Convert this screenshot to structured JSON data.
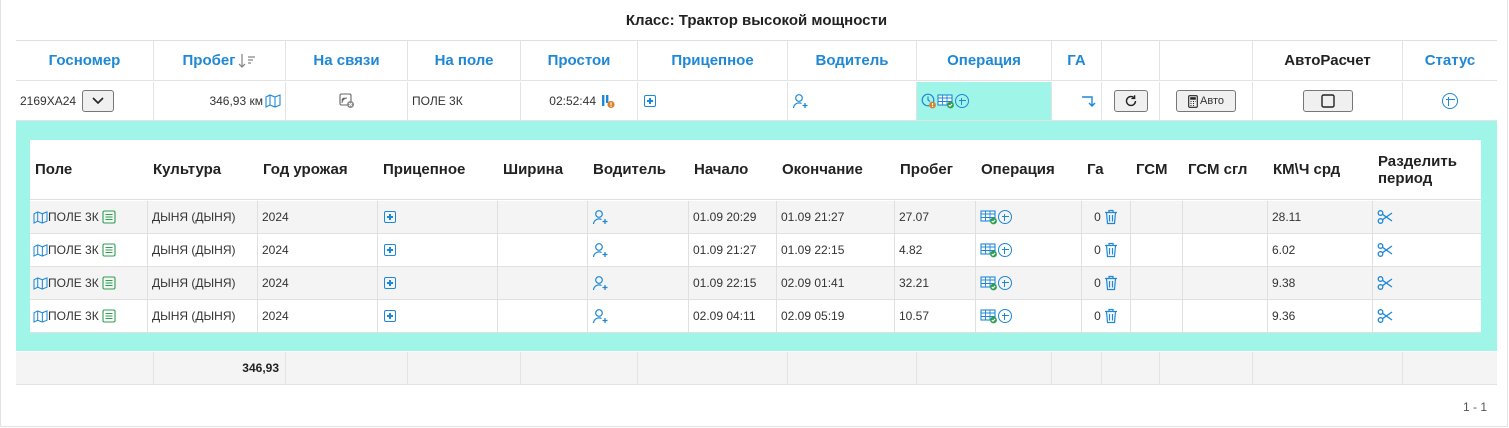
{
  "title": "Класс: Трактор высокой мощности",
  "main_columns": {
    "plate": "Госномер",
    "mileage": "Пробег",
    "online": "На связи",
    "in_field": "На поле",
    "idle": "Простои",
    "trailer": "Прицепное",
    "driver": "Водитель",
    "operation": "Операция",
    "ga": "ГА",
    "autocalc": "АвтоРасчет",
    "status": "Статус"
  },
  "vehicle": {
    "plate": "2169ХА24",
    "mileage": "346,93 км",
    "field": "ПОЛЕ 3К",
    "idle": "02:52:44",
    "auto_button": "Авто"
  },
  "sub_columns": {
    "field": "Поле",
    "crop": "Культура",
    "year": "Год урожая",
    "trailer": "Прицепное",
    "width": "Ширина",
    "driver": "Водитель",
    "start": "Начало",
    "end": "Окончание",
    "mileage": "Пробег",
    "operation": "Операция",
    "ga": "Га",
    "fuel": "ГСМ",
    "fuel_sgl": "ГСМ сгл",
    "speed": "КМ\\Ч срд",
    "split_line1": "Разделить",
    "split_line2": "период"
  },
  "rows": [
    {
      "field": "ПОЛЕ 3К",
      "crop": "ДЫНЯ (ДЫНЯ)",
      "year": "2024",
      "start": "01.09 20:29",
      "end": "01.09 21:27",
      "mileage": "27.07",
      "ga": "0",
      "speed": "28.11"
    },
    {
      "field": "ПОЛЕ 3К",
      "crop": "ДЫНЯ (ДЫНЯ)",
      "year": "2024",
      "start": "01.09 21:27",
      "end": "01.09 22:15",
      "mileage": "4.82",
      "ga": "0",
      "speed": "6.02"
    },
    {
      "field": "ПОЛЕ 3К",
      "crop": "ДЫНЯ (ДЫНЯ)",
      "year": "2024",
      "start": "01.09 22:15",
      "end": "02.09 01:41",
      "mileage": "32.21",
      "ga": "0",
      "speed": "9.38"
    },
    {
      "field": "ПОЛЕ 3К",
      "crop": "ДЫНЯ (ДЫНЯ)",
      "year": "2024",
      "start": "02.09 04:11",
      "end": "02.09 05:19",
      "mileage": "10.57",
      "ga": "0",
      "speed": "9.36"
    }
  ],
  "footer": {
    "mileage_total": "346,93"
  },
  "pager": "1 - 1",
  "colors": {
    "accent": "#1e88d6",
    "panel": "#9ff5e8",
    "warning": "#d9822b",
    "ok": "#2e9e4f"
  }
}
